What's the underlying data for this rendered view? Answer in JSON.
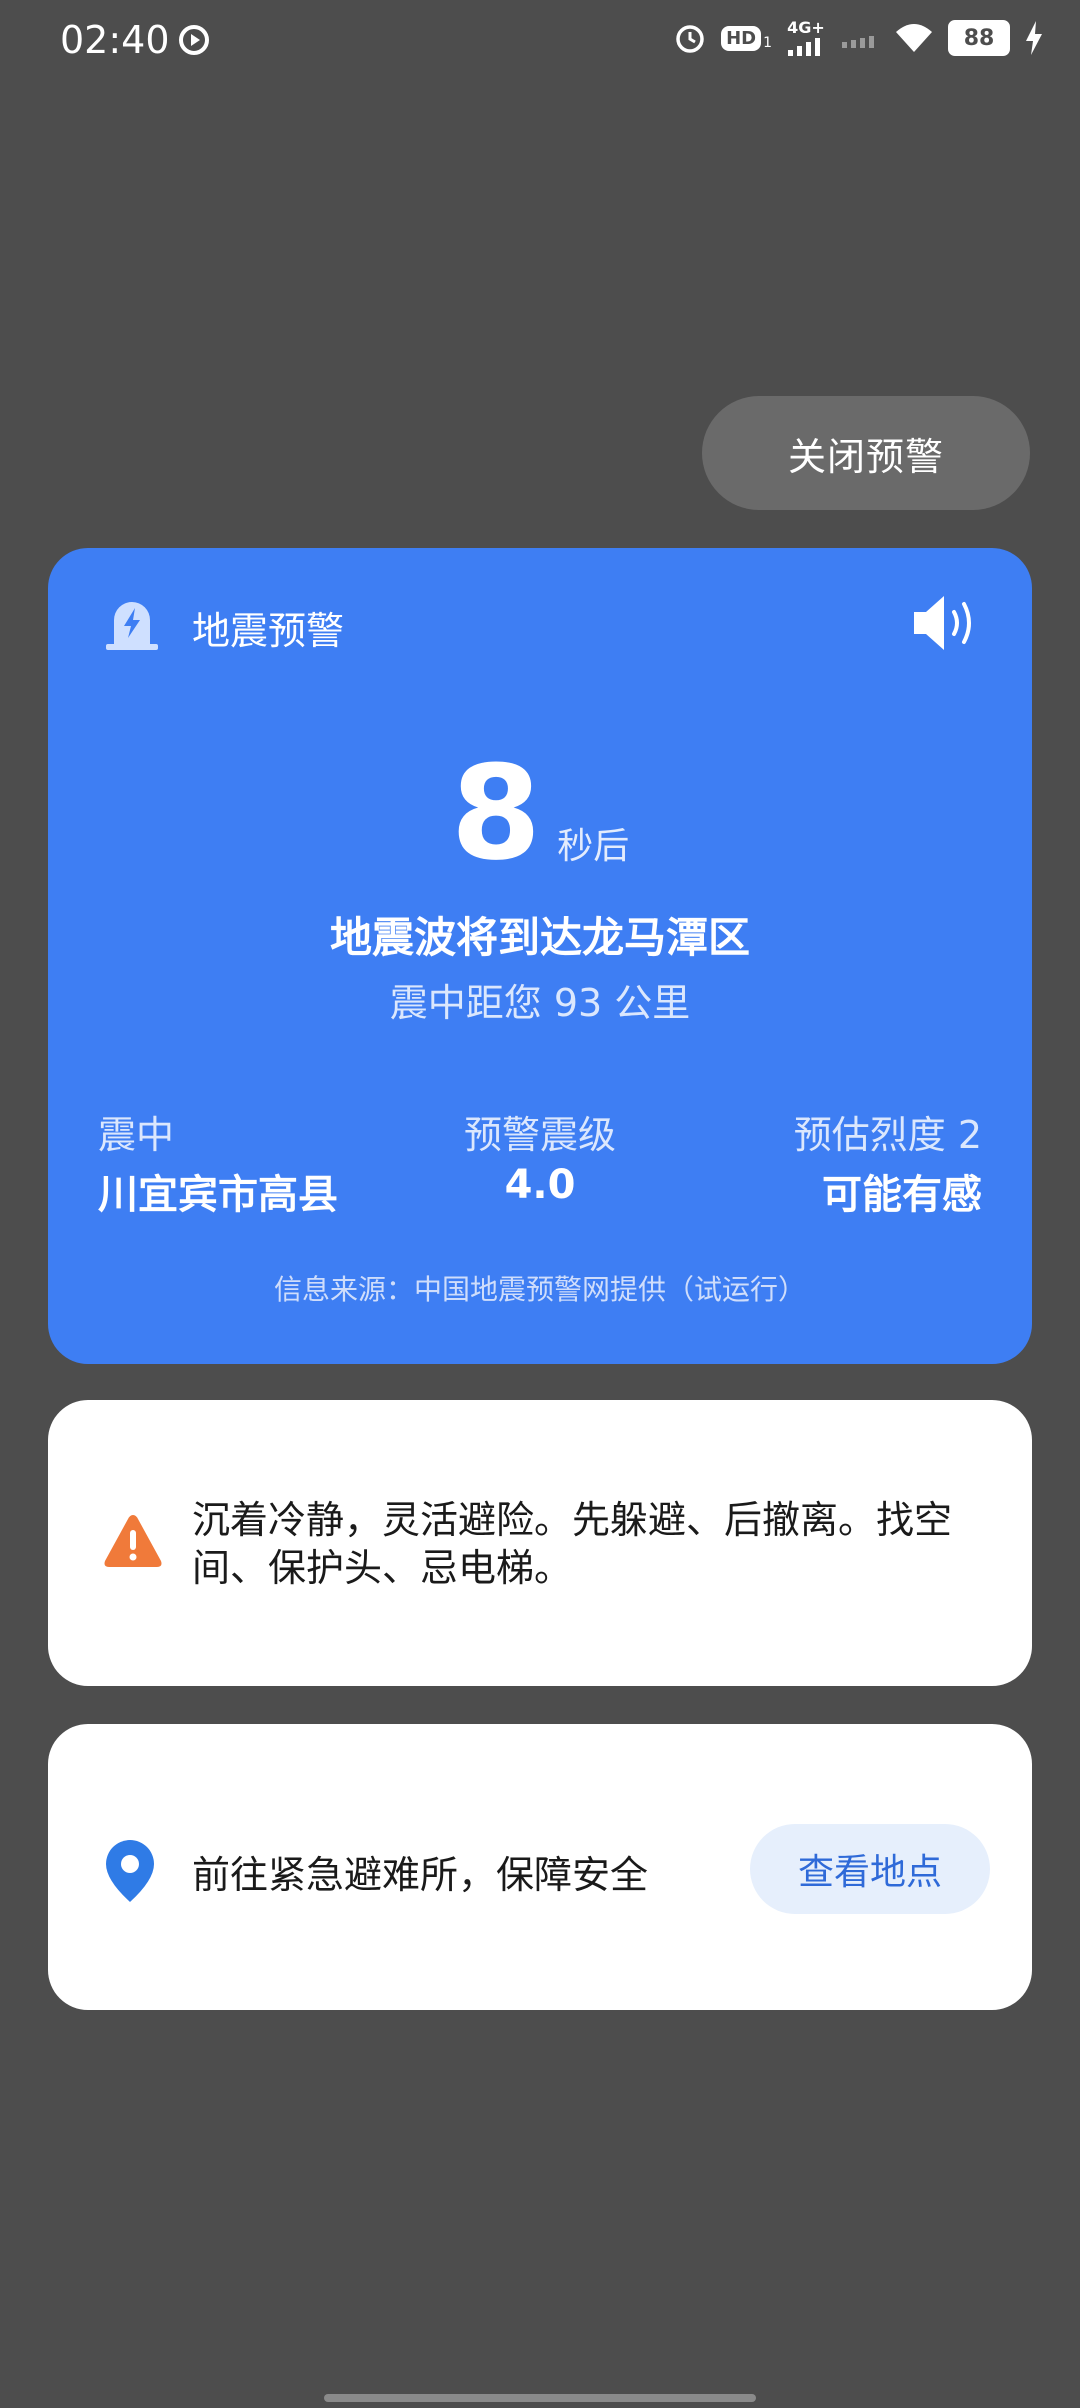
{
  "status_bar": {
    "time": "02:40",
    "hd_label": "HD",
    "network": "4G+",
    "battery": "88"
  },
  "close_button": {
    "label": "关闭预警"
  },
  "alert": {
    "title": "地震预警",
    "countdown_value": "8",
    "countdown_unit": "秒后",
    "arrival_text": "地震波将到达龙马潭区",
    "distance_text": "震中距您 93 公里",
    "epicenter_label": "震中",
    "epicenter_value": "川宜宾市高县",
    "magnitude_label": "预警震级",
    "magnitude_value": "4.0",
    "intensity_label": "预估烈度 2",
    "intensity_value": "可能有感",
    "source": "信息来源：中国地震预警网提供（试运行）"
  },
  "tip_card": {
    "text": "沉着冷静，灵活避险。先躲避、后撤离。找空间、保护头、忌电梯。"
  },
  "shelter_card": {
    "text": "前往紧急避难所，保障安全",
    "button_label": "查看地点"
  },
  "colors": {
    "background": "#4d4d4d",
    "alert_blue": "#3e7ef3",
    "warning_orange": "#f07a3a",
    "location_blue": "#2f7be6"
  }
}
